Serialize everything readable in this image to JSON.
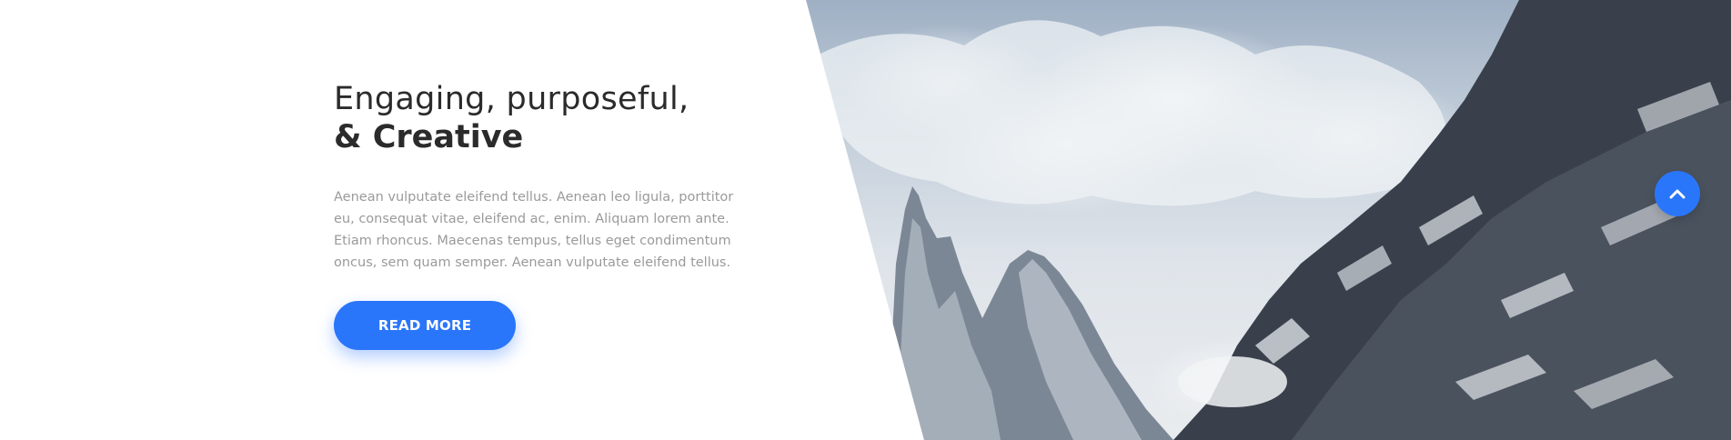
{
  "hero": {
    "headline_line1": "Engaging, purposeful,",
    "headline_line2": "& Creative",
    "body": "Aenean vulputate eleifend tellus. Aenean leo ligula, porttitor eu, consequat vitae, eleifend ac, enim. Aliquam lorem ante. Etiam rhoncus. Maecenas tempus, tellus eget condimentum oncus, sem quam semper. Aenean vulputate eleifend tellus.",
    "cta_label": "READ MORE"
  },
  "image": {
    "subject": "snowy mountain peaks under cloudy sky"
  },
  "scroll_top": {
    "icon": "chevron-up-icon"
  },
  "colors": {
    "accent": "#2a76fb",
    "headline": "#2b2b2b",
    "body_text": "#9a9a9a",
    "background": "#ffffff"
  }
}
